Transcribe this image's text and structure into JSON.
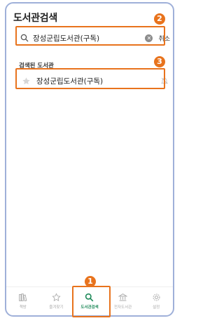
{
  "header": {
    "title": "도서관검색"
  },
  "search": {
    "query": "장성군립도서관(구독)",
    "cancel_label": "취소"
  },
  "results": {
    "section_label": "검색된 도서관",
    "items": [
      {
        "label": "장성군립도서관(구독)"
      }
    ]
  },
  "tabbar": {
    "items": [
      {
        "label": "책방",
        "icon": "books-icon"
      },
      {
        "label": "즐겨찾기",
        "icon": "star-icon"
      },
      {
        "label": "도서관검색",
        "icon": "search-icon",
        "active": true
      },
      {
        "label": "전자도서관",
        "icon": "library-icon"
      },
      {
        "label": "설정",
        "icon": "gear-icon"
      }
    ]
  },
  "annotations": {
    "callout_1": "1",
    "callout_2": "2",
    "callout_3": "3"
  },
  "colors": {
    "highlight": "#e8731d",
    "active_tab": "#1f8a5a",
    "frame": "#9fb0d9"
  }
}
